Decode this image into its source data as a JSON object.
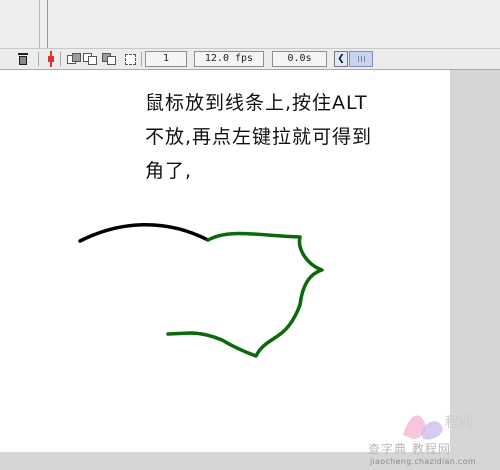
{
  "timeline": {
    "frame_number": "1",
    "frame_rate": "12.0 fps",
    "elapsed_time": "0.0s",
    "icons": [
      "trash-icon",
      "playhead-icon",
      "onion-skin-icon",
      "onion-skin-outlines-icon",
      "edit-multiple-frames-icon",
      "modify-onion-markers-icon",
      "scroll-left-icon"
    ]
  },
  "stage": {
    "instruction_lines": [
      "鼠标放到线条上,按住ALT",
      "不放,再点左键拉就可得到",
      "角了,"
    ],
    "stroke_colors": {
      "original_line": "#000000",
      "new_line": "#0a6a0a"
    }
  },
  "watermark": {
    "brand_text": "查字典 教程网",
    "url_text": "jiaocheng.chazidian.com"
  }
}
